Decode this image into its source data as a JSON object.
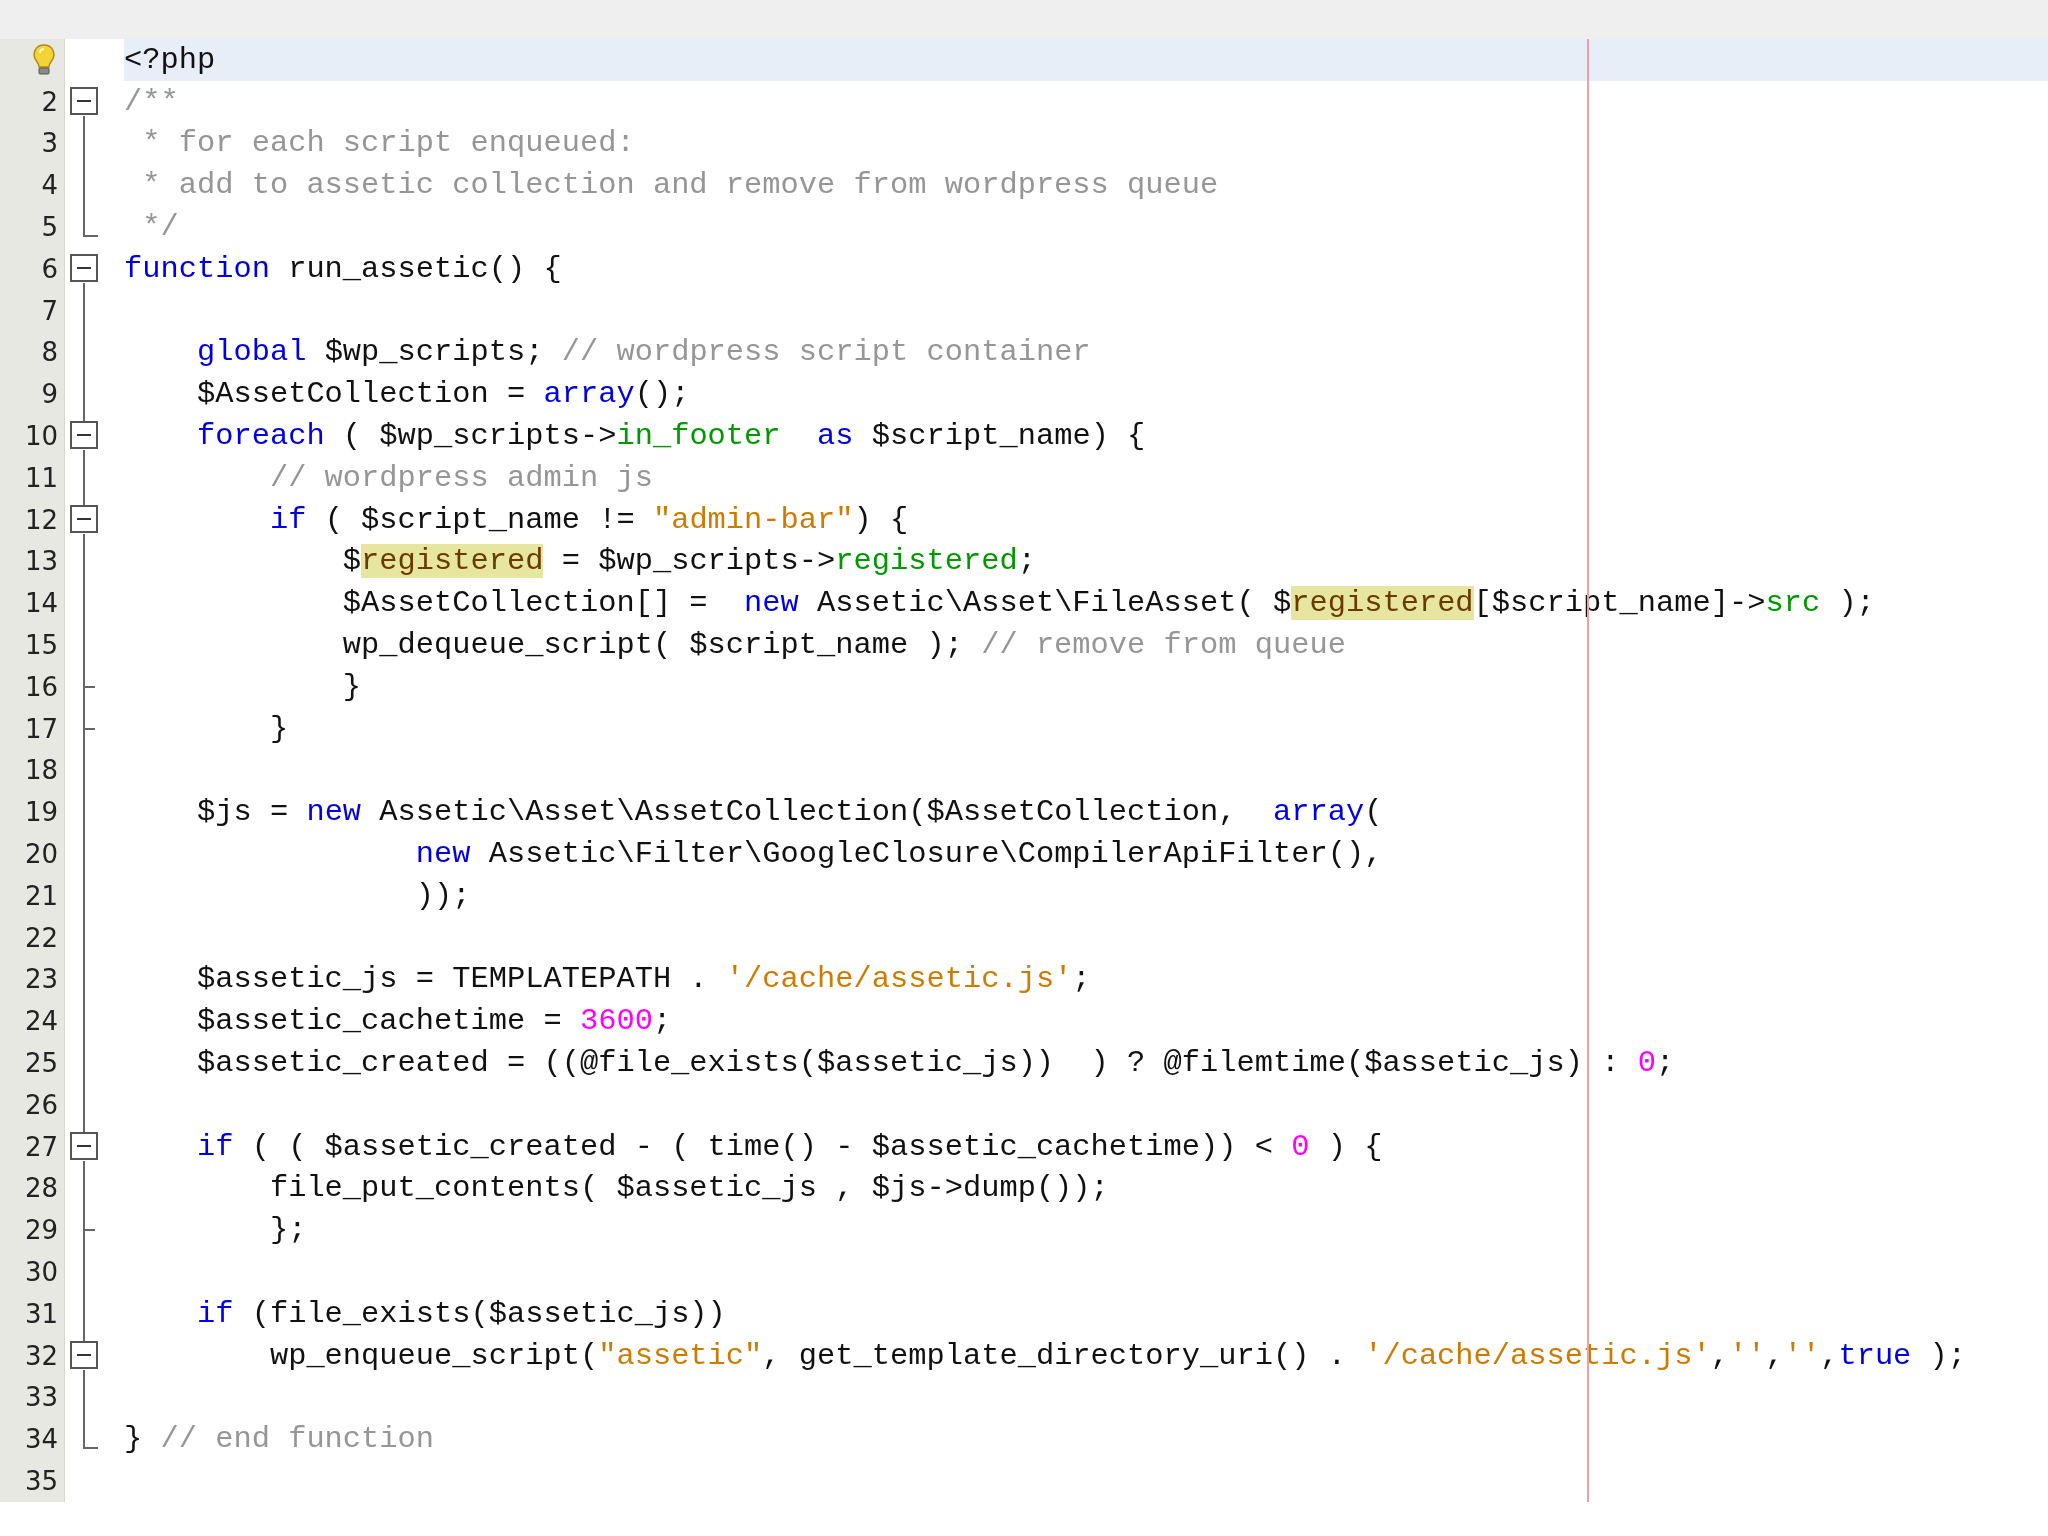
{
  "editor": {
    "lines": [
      {
        "hint": true,
        "current": true,
        "tokens": [
          {
            "text": "<?php",
            "kind": "plain"
          }
        ]
      },
      {
        "number": "2",
        "hint": false,
        "current": false,
        "fold": {
          "kind": "start"
        },
        "tokens": [
          {
            "text": "/**",
            "kind": "comment"
          }
        ]
      },
      {
        "number": "3",
        "hint": false,
        "current": false,
        "fold": {
          "kind": "bar"
        },
        "tokens": [
          {
            "text": " * for each script enqueued:",
            "kind": "comment"
          }
        ]
      },
      {
        "number": "4",
        "hint": false,
        "current": false,
        "fold": {
          "kind": "bar"
        },
        "tokens": [
          {
            "text": " * add to assetic collection and remove from wordpress queue",
            "kind": "comment"
          }
        ]
      },
      {
        "number": "5",
        "hint": false,
        "current": false,
        "fold": {
          "kind": "end"
        },
        "tokens": [
          {
            "text": " */",
            "kind": "comment"
          }
        ]
      },
      {
        "number": "6",
        "hint": false,
        "current": false,
        "fold": {
          "kind": "start"
        },
        "tokens": [
          {
            "text": "function",
            "kind": "keyword"
          },
          {
            "text": " run_assetic() {",
            "kind": "plain"
          }
        ]
      },
      {
        "number": "7",
        "hint": false,
        "current": false,
        "fold": {
          "kind": "bar"
        }
      },
      {
        "number": "8",
        "hint": false,
        "current": false,
        "fold": {
          "kind": "bar"
        },
        "tokens": [
          {
            "text": "    global",
            "kind": "keyword"
          },
          {
            "text": " $wp_scripts; ",
            "kind": "plain"
          },
          {
            "text": "// wordpress script container",
            "kind": "comment"
          }
        ]
      },
      {
        "number": "9",
        "hint": false,
        "current": false,
        "fold": {
          "kind": "bar"
        },
        "tokens": [
          {
            "text": "    $AssetCollection = ",
            "kind": "plain"
          },
          {
            "text": "array",
            "kind": "keyword"
          },
          {
            "text": "();",
            "kind": "plain"
          }
        ]
      },
      {
        "number": "10",
        "hint": false,
        "current": false,
        "fold": {
          "kind": "start"
        },
        "tokens": [
          {
            "text": "    foreach",
            "kind": "keyword"
          },
          {
            "text": " ( $wp_scripts->",
            "kind": "plain"
          },
          {
            "text": "in_footer  ",
            "kind": "field"
          },
          {
            "text": "as",
            "kind": "keyword"
          },
          {
            "text": " $script_name) {",
            "kind": "plain"
          }
        ]
      },
      {
        "number": "11",
        "hint": false,
        "current": false,
        "fold": {
          "kind": "bar"
        },
        "tokens": [
          {
            "text": "        // wordpress admin js",
            "kind": "comment"
          }
        ]
      },
      {
        "number": "12",
        "hint": false,
        "current": false,
        "fold": {
          "kind": "start"
        },
        "tokens": [
          {
            "text": "        if",
            "kind": "keyword"
          },
          {
            "text": " ( $script_name != ",
            "kind": "plain"
          },
          {
            "text": "\"admin-bar\"",
            "kind": "string"
          },
          {
            "text": ") {",
            "kind": "plain"
          }
        ]
      },
      {
        "number": "13",
        "hint": false,
        "current": false,
        "fold": {
          "kind": "bar"
        },
        "tokens": [
          {
            "text": "            $",
            "kind": "plain"
          },
          {
            "text": "registered",
            "kind": "highlight"
          },
          {
            "text": " = $wp_scripts->",
            "kind": "plain"
          },
          {
            "text": "registered",
            "kind": "field"
          },
          {
            "text": ";",
            "kind": "plain"
          }
        ]
      },
      {
        "number": "14",
        "hint": false,
        "current": false,
        "fold": {
          "kind": "bar"
        },
        "tokens": [
          {
            "text": "            $AssetCollection[] =  ",
            "kind": "plain"
          },
          {
            "text": "new",
            "kind": "keyword"
          },
          {
            "text": " Assetic\\Asset\\FileAsset( $",
            "kind": "plain"
          },
          {
            "text": "registered",
            "kind": "highlight"
          },
          {
            "text": "[$script_name]->",
            "kind": "plain"
          },
          {
            "text": "src",
            "kind": "field"
          },
          {
            "text": " );",
            "kind": "plain"
          }
        ]
      },
      {
        "number": "15",
        "hint": false,
        "current": false,
        "fold": {
          "kind": "bar"
        },
        "tokens": [
          {
            "text": "            wp_dequeue_script( $script_name ); ",
            "kind": "plain"
          },
          {
            "text": "// remove from queue",
            "kind": "comment"
          }
        ]
      },
      {
        "number": "16",
        "hint": false,
        "current": false,
        "fold": {
          "kind": "tick"
        },
        "tokens": [
          {
            "text": "            }",
            "kind": "plain"
          }
        ]
      },
      {
        "number": "17",
        "hint": false,
        "current": false,
        "fold": {
          "kind": "tick"
        },
        "tokens": [
          {
            "text": "        }",
            "kind": "plain"
          }
        ]
      },
      {
        "number": "18",
        "hint": false,
        "current": false,
        "fold": {
          "kind": "bar"
        }
      },
      {
        "number": "19",
        "hint": false,
        "current": false,
        "fold": {
          "kind": "bar"
        },
        "tokens": [
          {
            "text": "    $js = ",
            "kind": "plain"
          },
          {
            "text": "new",
            "kind": "keyword"
          },
          {
            "text": " Assetic\\Asset\\AssetCollection($AssetCollection,  ",
            "kind": "plain"
          },
          {
            "text": "array",
            "kind": "keyword"
          },
          {
            "text": "(",
            "kind": "plain"
          }
        ]
      },
      {
        "number": "20",
        "hint": false,
        "current": false,
        "fold": {
          "kind": "bar"
        },
        "tokens": [
          {
            "text": "                new",
            "kind": "keyword"
          },
          {
            "text": " Assetic\\Filter\\GoogleClosure\\CompilerApiFilter(),",
            "kind": "plain"
          }
        ]
      },
      {
        "number": "21",
        "hint": false,
        "current": false,
        "fold": {
          "kind": "bar"
        },
        "tokens": [
          {
            "text": "                ));",
            "kind": "plain"
          }
        ]
      },
      {
        "number": "22",
        "hint": false,
        "current": false,
        "fold": {
          "kind": "bar"
        }
      },
      {
        "number": "23",
        "hint": false,
        "current": false,
        "fold": {
          "kind": "bar"
        },
        "tokens": [
          {
            "text": "    $assetic_js = TEMPLATEPATH . ",
            "kind": "plain"
          },
          {
            "text": "'/cache/assetic.js'",
            "kind": "string"
          },
          {
            "text": ";",
            "kind": "plain"
          }
        ]
      },
      {
        "number": "24",
        "hint": false,
        "current": false,
        "fold": {
          "kind": "bar"
        },
        "tokens": [
          {
            "text": "    $assetic_cachetime = ",
            "kind": "plain"
          },
          {
            "text": "3600",
            "kind": "number"
          },
          {
            "text": ";",
            "kind": "plain"
          }
        ]
      },
      {
        "number": "25",
        "hint": false,
        "current": false,
        "fold": {
          "kind": "bar"
        },
        "tokens": [
          {
            "text": "    $assetic_created = ((@file_exists($assetic_js))  ) ? @filemtime($assetic_js) : ",
            "kind": "plain"
          },
          {
            "text": "0",
            "kind": "number"
          },
          {
            "text": ";",
            "kind": "plain"
          }
        ]
      },
      {
        "number": "26",
        "hint": false,
        "current": false,
        "fold": {
          "kind": "bar"
        }
      },
      {
        "number": "27",
        "hint": false,
        "current": false,
        "fold": {
          "kind": "start"
        },
        "tokens": [
          {
            "text": "    if",
            "kind": "keyword"
          },
          {
            "text": " ( ( $assetic_created - ( time() - $assetic_cachetime)) < ",
            "kind": "plain"
          },
          {
            "text": "0",
            "kind": "number"
          },
          {
            "text": " ) {",
            "kind": "plain"
          }
        ]
      },
      {
        "number": "28",
        "hint": false,
        "current": false,
        "fold": {
          "kind": "bar"
        },
        "tokens": [
          {
            "text": "        file_put_contents( $assetic_js , $js->dump());",
            "kind": "plain"
          }
        ]
      },
      {
        "number": "29",
        "hint": false,
        "current": false,
        "fold": {
          "kind": "tick"
        },
        "tokens": [
          {
            "text": "        };",
            "kind": "plain"
          }
        ]
      },
      {
        "number": "30",
        "hint": false,
        "current": false,
        "fold": {
          "kind": "bar"
        }
      },
      {
        "number": "31",
        "hint": false,
        "current": false,
        "fold": {
          "kind": "bar"
        },
        "tokens": [
          {
            "text": "    if",
            "kind": "keyword"
          },
          {
            "text": " (file_exists($assetic_js))",
            "kind": "plain"
          }
        ]
      },
      {
        "number": "32",
        "hint": false,
        "current": false,
        "fold": {
          "kind": "start"
        },
        "tokens": [
          {
            "text": "        wp_enqueue_script(",
            "kind": "plain"
          },
          {
            "text": "\"assetic\"",
            "kind": "string"
          },
          {
            "text": ", get_template_directory_uri() . ",
            "kind": "plain"
          },
          {
            "text": "'/cache/assetic.js'",
            "kind": "string"
          },
          {
            "text": ",",
            "kind": "plain"
          },
          {
            "text": "''",
            "kind": "string"
          },
          {
            "text": ",",
            "kind": "plain"
          },
          {
            "text": "''",
            "kind": "string"
          },
          {
            "text": ",",
            "kind": "plain"
          },
          {
            "text": "true",
            "kind": "keyword"
          },
          {
            "text": " );",
            "kind": "plain"
          }
        ]
      },
      {
        "number": "33",
        "hint": false,
        "current": false,
        "fold": {
          "kind": "bar"
        }
      },
      {
        "number": "34",
        "hint": false,
        "current": false,
        "fold": {
          "kind": "end"
        },
        "tokens": [
          {
            "text": "} ",
            "kind": "plain"
          },
          {
            "text": "// end function",
            "kind": "comment"
          }
        ]
      },
      {
        "number": "35",
        "hint": false,
        "current": false
      }
    ]
  }
}
